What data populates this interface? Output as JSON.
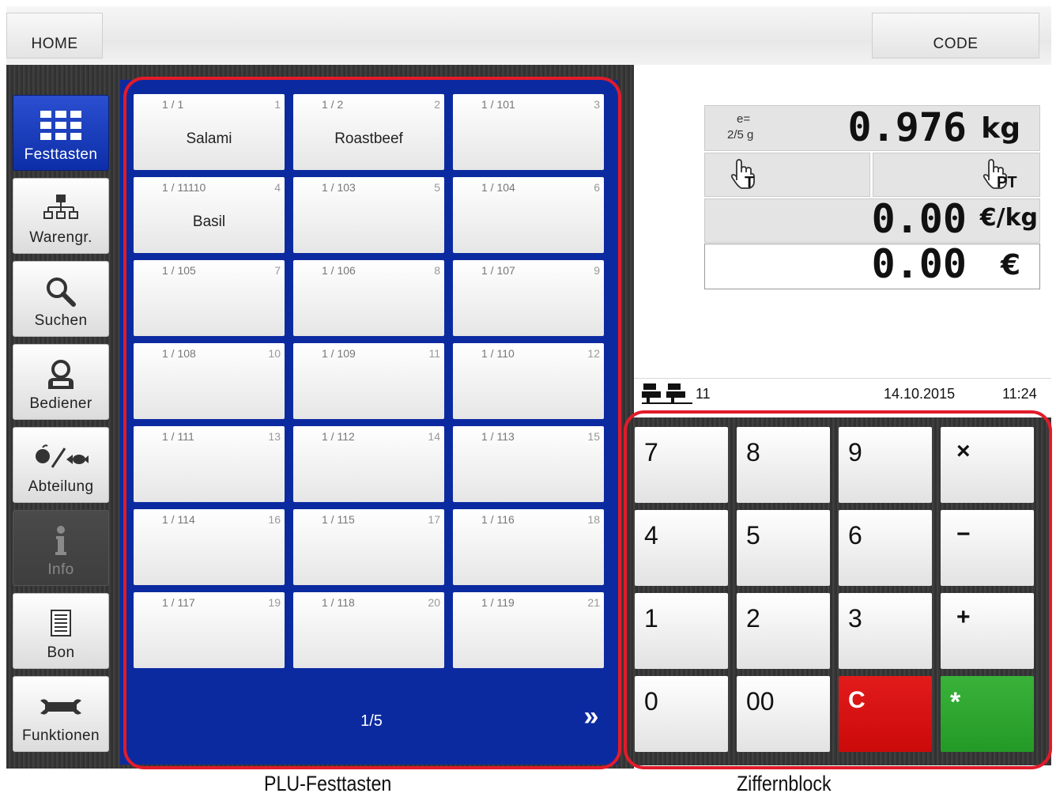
{
  "header": {
    "home_label": "HOME",
    "code_label": "CODE"
  },
  "sidebar": {
    "items": [
      {
        "label": "Festtasten",
        "icon": "grid-icon",
        "state": "active"
      },
      {
        "label": "Warengr.",
        "icon": "hierarchy-icon",
        "state": "normal"
      },
      {
        "label": "Suchen",
        "icon": "magnifier-icon",
        "state": "normal"
      },
      {
        "label": "Bediener",
        "icon": "operator-icon",
        "state": "normal"
      },
      {
        "label": "Abteilung",
        "icon": "department-icon",
        "state": "normal"
      },
      {
        "label": "Info",
        "icon": "info-icon",
        "state": "disabled"
      },
      {
        "label": "Bon",
        "icon": "receipt-icon",
        "state": "normal"
      },
      {
        "label": "Funktionen",
        "icon": "wrench-icon",
        "state": "normal"
      }
    ]
  },
  "plu": {
    "keys": [
      {
        "code": "1 / 1",
        "index": "1",
        "name": "Salami"
      },
      {
        "code": "1 / 2",
        "index": "2",
        "name": "Roastbeef"
      },
      {
        "code": "1 / 101",
        "index": "3",
        "name": ""
      },
      {
        "code": "1 / 11110",
        "index": "4",
        "name": "Basil"
      },
      {
        "code": "1 / 103",
        "index": "5",
        "name": ""
      },
      {
        "code": "1 / 104",
        "index": "6",
        "name": ""
      },
      {
        "code": "1 / 105",
        "index": "7",
        "name": ""
      },
      {
        "code": "1 / 106",
        "index": "8",
        "name": ""
      },
      {
        "code": "1 / 107",
        "index": "9",
        "name": ""
      },
      {
        "code": "1 / 108",
        "index": "10",
        "name": ""
      },
      {
        "code": "1 / 109",
        "index": "11",
        "name": ""
      },
      {
        "code": "1 / 110",
        "index": "12",
        "name": ""
      },
      {
        "code": "1 / 111",
        "index": "13",
        "name": ""
      },
      {
        "code": "1 / 112",
        "index": "14",
        "name": ""
      },
      {
        "code": "1 / 113",
        "index": "15",
        "name": ""
      },
      {
        "code": "1 / 114",
        "index": "16",
        "name": ""
      },
      {
        "code": "1 / 115",
        "index": "17",
        "name": ""
      },
      {
        "code": "1 / 116",
        "index": "18",
        "name": ""
      },
      {
        "code": "1 / 117",
        "index": "19",
        "name": ""
      },
      {
        "code": "1 / 118",
        "index": "20",
        "name": ""
      },
      {
        "code": "1 / 119",
        "index": "21",
        "name": ""
      }
    ],
    "page": "1/5",
    "next_glyph": "»"
  },
  "scale": {
    "e_label": "e=",
    "e_value": "2/5 g",
    "weight": "0.976",
    "weight_unit": "kg",
    "tare_label": "T",
    "preset_tare_label": "PT",
    "unit_price": "0.00",
    "unit_price_unit": "€/kg",
    "total": "0.00",
    "total_unit": "€"
  },
  "status": {
    "operator_count": "11",
    "date": "14.10.2015",
    "time": "11:24"
  },
  "numpad": {
    "keys": [
      {
        "label": "7",
        "kind": "digit"
      },
      {
        "label": "8",
        "kind": "digit"
      },
      {
        "label": "9",
        "kind": "digit"
      },
      {
        "label": "×",
        "kind": "op"
      },
      {
        "label": "4",
        "kind": "digit"
      },
      {
        "label": "5",
        "kind": "digit"
      },
      {
        "label": "6",
        "kind": "digit"
      },
      {
        "label": "−",
        "kind": "op"
      },
      {
        "label": "1",
        "kind": "digit"
      },
      {
        "label": "2",
        "kind": "digit"
      },
      {
        "label": "3",
        "kind": "digit"
      },
      {
        "label": "+",
        "kind": "op"
      },
      {
        "label": "0",
        "kind": "digit"
      },
      {
        "label": "00",
        "kind": "digit"
      },
      {
        "label": "C",
        "kind": "clear"
      },
      {
        "label": "*",
        "kind": "enter"
      }
    ]
  },
  "captions": {
    "plu": "PLU-Festtasten",
    "numpad": "Ziffernblock"
  },
  "colors": {
    "plu_panel": "#0c2aa0",
    "active_nav": "#1a3fc4",
    "clear_key": "#d81414",
    "enter_key": "#2fa830",
    "highlight_frame": "#e21b2a"
  }
}
